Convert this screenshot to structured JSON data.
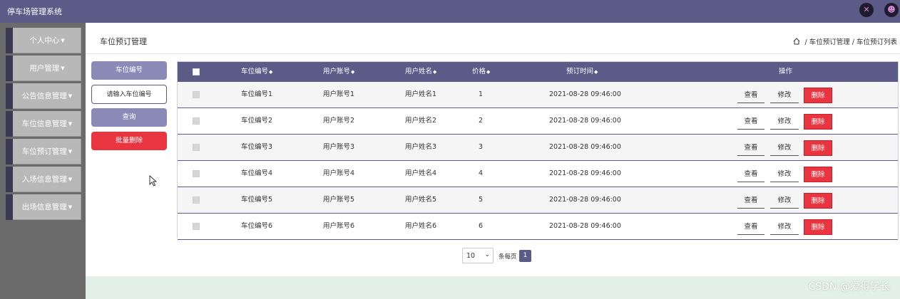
{
  "app": {
    "title": "停车场管理系统"
  },
  "topbar": {
    "icons": [
      "expand-icon",
      "user-icon"
    ]
  },
  "sidebar": {
    "items": [
      {
        "label": "个人中心"
      },
      {
        "label": "用户管理"
      },
      {
        "label": "公告信息管理"
      },
      {
        "label": "车位信息管理"
      },
      {
        "label": "车位预订管理"
      },
      {
        "label": "入场信息管理"
      },
      {
        "label": "出场信息管理"
      }
    ]
  },
  "header": {
    "title": "车位预订管理",
    "breadcrumb": [
      "车位预订管理",
      "车位预订列表"
    ]
  },
  "search": {
    "field_label": "车位编号",
    "placeholder": "请输入车位编号",
    "query_label": "查询",
    "batch_delete_label": "批量删除"
  },
  "table": {
    "columns": [
      "车位编号",
      "用户账号",
      "用户姓名",
      "价格",
      "预订时间",
      "操作"
    ],
    "rows": [
      {
        "space_no": "车位编号1",
        "account": "用户账号1",
        "name": "用户姓名1",
        "price": "1",
        "time": "2021-08-28 09:46:00"
      },
      {
        "space_no": "车位编号2",
        "account": "用户账号2",
        "name": "用户姓名2",
        "price": "2",
        "time": "2021-08-28 09:46:00"
      },
      {
        "space_no": "车位编号3",
        "account": "用户账号3",
        "name": "用户姓名3",
        "price": "3",
        "time": "2021-08-28 09:46:00"
      },
      {
        "space_no": "车位编号4",
        "account": "用户账号4",
        "name": "用户姓名4",
        "price": "4",
        "time": "2021-08-28 09:46:00"
      },
      {
        "space_no": "车位编号5",
        "account": "用户账号5",
        "name": "用户姓名5",
        "price": "5",
        "time": "2021-08-28 09:46:00"
      },
      {
        "space_no": "车位编号6",
        "account": "用户账号6",
        "name": "用户姓名6",
        "price": "6",
        "time": "2021-08-28 09:46:00"
      }
    ],
    "actions": {
      "view": "查看",
      "edit": "修改",
      "delete": "删除"
    }
  },
  "pagination": {
    "page_size": "10",
    "per_page_label": "条每页",
    "current_page": "1"
  },
  "watermark": "CSDN @爱得学长",
  "colors": {
    "primary": "#5c5a87",
    "danger": "#e8353f",
    "sidebar": "#6b6b6b",
    "sidebar_item": "#b8b8b8"
  }
}
